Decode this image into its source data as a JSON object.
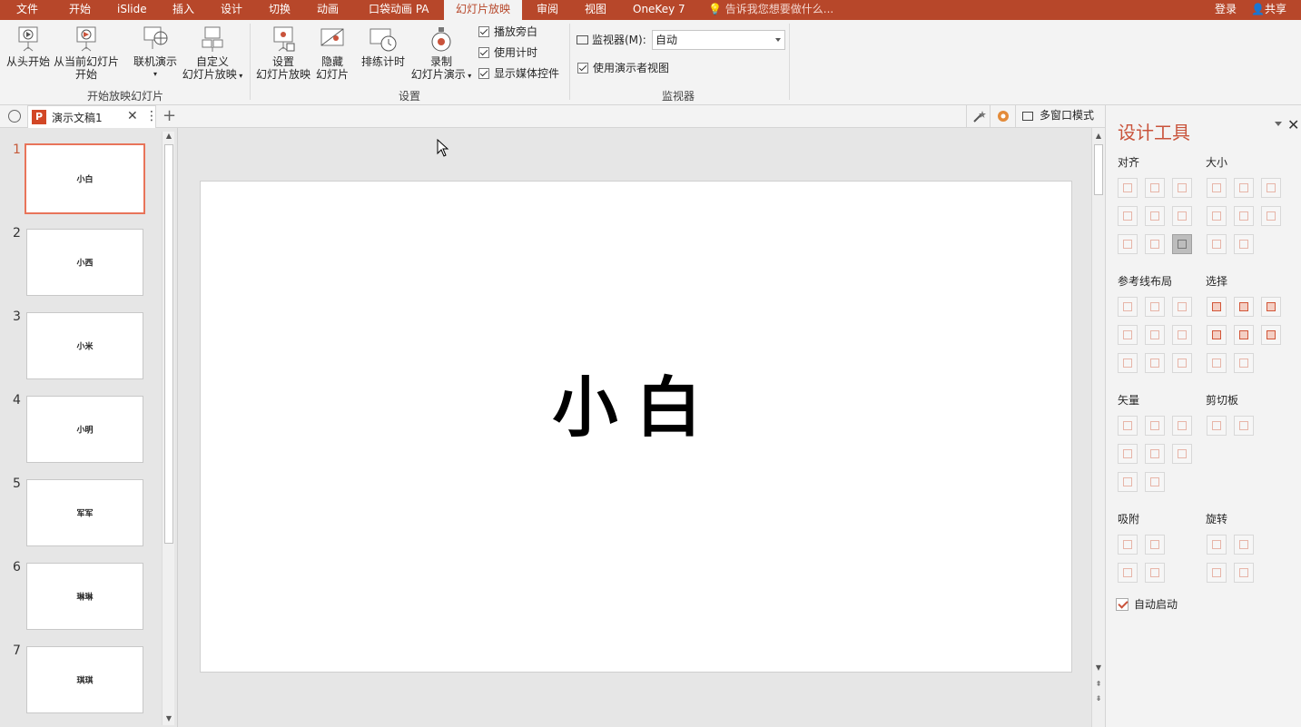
{
  "tabs": [
    "文件",
    "开始",
    "iSlide",
    "插入",
    "设计",
    "切换",
    "动画",
    "口袋动画 PA",
    "幻灯片放映",
    "审阅",
    "视图",
    "OneKey 7"
  ],
  "active_tab": "幻灯片放映",
  "tell_me": "告诉我您想要做什么...",
  "login": "登录",
  "share": "共享",
  "ribbon": {
    "from_start": "从头开始",
    "from_current_1": "从当前幻灯片",
    "from_current_2": "开始",
    "online": "联机演示",
    "custom_1": "自定义",
    "custom_2": "幻灯片放映",
    "group_start": "开始放映幻灯片",
    "setup_1": "设置",
    "setup_2": "幻灯片放映",
    "hide_1": "隐藏",
    "hide_2": "幻灯片",
    "rehearse": "排练计时",
    "record_1": "录制",
    "record_2": "幻灯片演示",
    "play_narration": "播放旁白",
    "use_timing": "使用计时",
    "show_media": "显示媒体控件",
    "group_setup": "设置",
    "monitor_label": "监视器(M):",
    "monitor_value": "自动",
    "presenter_view": "使用演示者视图",
    "group_monitor": "监视器"
  },
  "doc_tab": {
    "title": "演示文稿1",
    "close": "✕",
    "more": "⋮",
    "add": "+"
  },
  "multi_window": "多窗口模式",
  "slides": [
    {
      "num": "1",
      "title": "小白"
    },
    {
      "num": "2",
      "title": "小西"
    },
    {
      "num": "3",
      "title": "小米"
    },
    {
      "num": "4",
      "title": "小明"
    },
    {
      "num": "5",
      "title": "军军"
    },
    {
      "num": "6",
      "title": "琳琳"
    },
    {
      "num": "7",
      "title": "琪琪"
    }
  ],
  "current_slide_title": "小白",
  "pane": {
    "title": "设计工具",
    "close": "✕",
    "align": "对齐",
    "size": "大小",
    "guides": "参考线布局",
    "select": "选择",
    "vector": "矢量",
    "clipboard": "剪切板",
    "snap": "吸附",
    "rotate": "旋转",
    "auto_start": "自动启动"
  }
}
